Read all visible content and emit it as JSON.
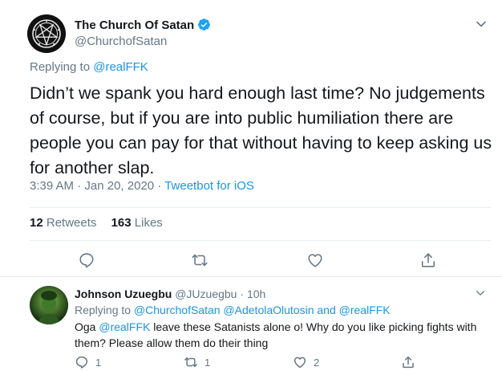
{
  "main_tweet": {
    "display_name": "The Church Of Satan",
    "handle": "@ChurchofSatan",
    "replying_prefix": "Replying to",
    "replying_to": "@realFFK",
    "text": "Didn’t we spank you hard enough last time? No judgements of course, but if you are into public humiliation there are people you can pay for that without having to keep asking us for another slap.",
    "time": "3:39 AM",
    "date": "Jan 20, 2020",
    "client": "Tweetbot for iOS",
    "retweets_count": "12",
    "retweets_label": "Retweets",
    "likes_count": "163",
    "likes_label": "Likes"
  },
  "reply_tweet": {
    "display_name": "Johnson Uzuegbu",
    "handle": "@JUzuegbu",
    "time_ago": "10h",
    "replying_prefix": "Replying to",
    "mention_1": "@ChurchofSatan",
    "mention_2": "@AdetolaOlutosin",
    "and_word": "and",
    "mention_3": "@realFFK",
    "text_before": "Oga",
    "text_mention": "@realFFK",
    "text_after": " leave these Satanists alone o! Why do you like picking fights with them? Please allow them do their thing",
    "reply_count": "1",
    "retweet_count": "1",
    "like_count": "2"
  },
  "colors": {
    "link": "#1b95e0",
    "muted": "#657786",
    "text": "#14171a",
    "divider": "#e6ecf0"
  },
  "icons": [
    "sigil-avatar",
    "verified-badge-icon",
    "chevron-down-icon",
    "reply-icon",
    "retweet-icon",
    "like-icon",
    "share-icon"
  ]
}
